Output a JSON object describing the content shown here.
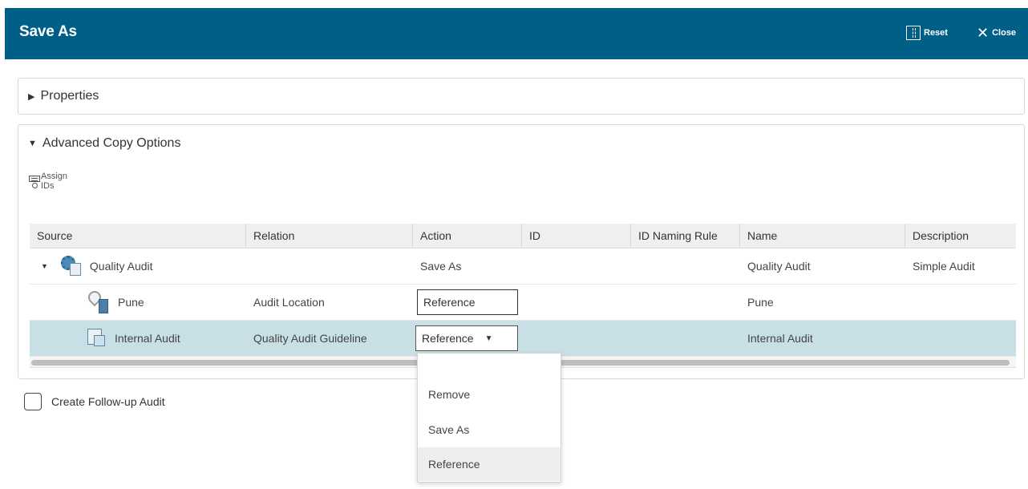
{
  "dialog": {
    "title": "Save As",
    "reset_label": "Reset",
    "close_label": "Close",
    "header_color": "#005f87"
  },
  "properties": {
    "label": "Properties",
    "expanded": false
  },
  "advanced": {
    "label": "Advanced Copy Options",
    "expanded": true,
    "assign_ids": {
      "line1": "Assign",
      "line2": "IDs"
    },
    "columns": [
      "Source",
      "Relation",
      "Action",
      "ID",
      "ID Naming Rule",
      "Name",
      "Description"
    ],
    "rows": [
      {
        "source": "Quality Audit",
        "icon": "audit-icon",
        "relation": "",
        "action": "Save As",
        "id": "",
        "rule": "",
        "name": "Quality Audit",
        "description": "Simple Audit"
      },
      {
        "source": "Pune",
        "icon": "location-icon",
        "relation": "Audit Location",
        "action": "Reference",
        "id": "",
        "rule": "",
        "name": "Pune",
        "description": ""
      },
      {
        "source": "Internal Audit",
        "icon": "guideline-icon",
        "relation": "Quality Audit Guideline",
        "action": "Reference",
        "id": "",
        "rule": "",
        "name": "Internal Audit",
        "description": "",
        "selected": true
      }
    ],
    "selected_row_color": "#c8e0e5"
  },
  "follow_up": {
    "label": "Create Follow-up Audit",
    "checked": false
  },
  "action_menu": {
    "options": [
      "Remove",
      "Save As",
      "Reference"
    ],
    "highlighted": "Reference"
  }
}
